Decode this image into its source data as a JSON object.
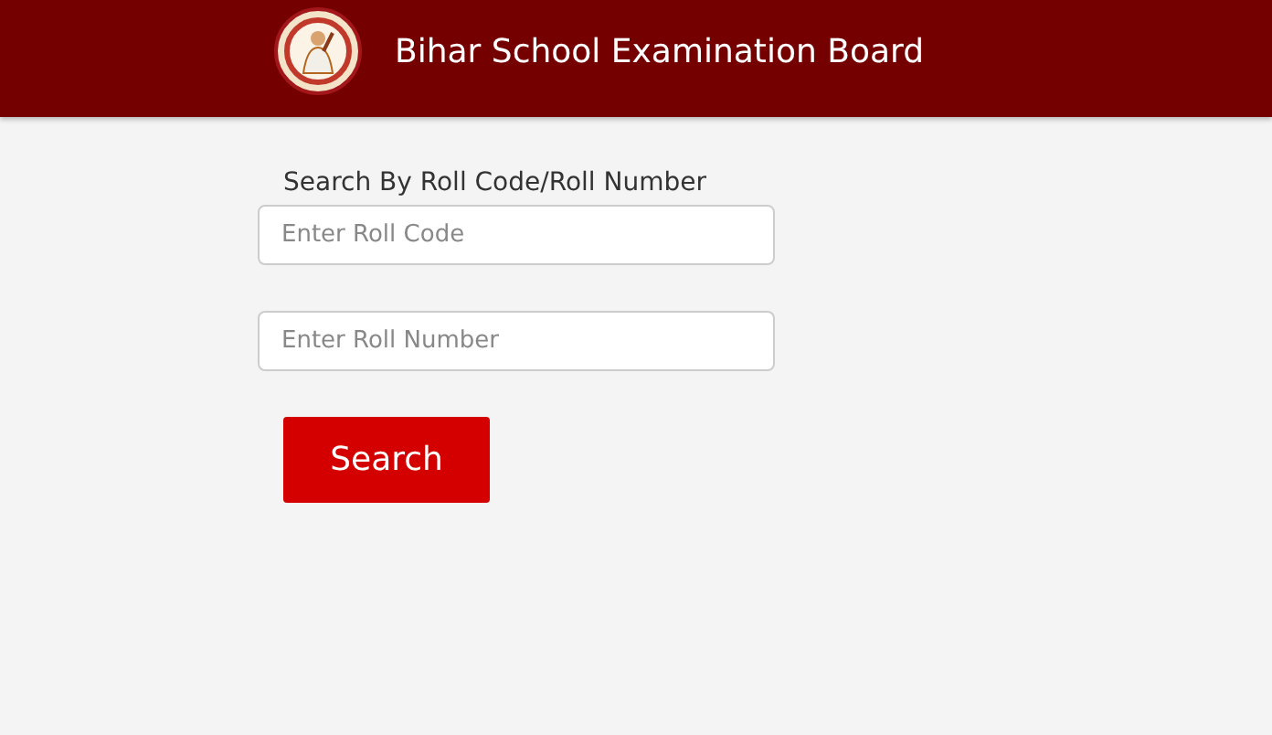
{
  "header": {
    "title": "Bihar School Examination Board"
  },
  "form": {
    "heading": "Search By Roll Code/Roll Number",
    "fields": [
      {
        "placeholder": "Enter Roll Code"
      },
      {
        "placeholder": "Enter Roll Number"
      }
    ],
    "button": "Search"
  }
}
